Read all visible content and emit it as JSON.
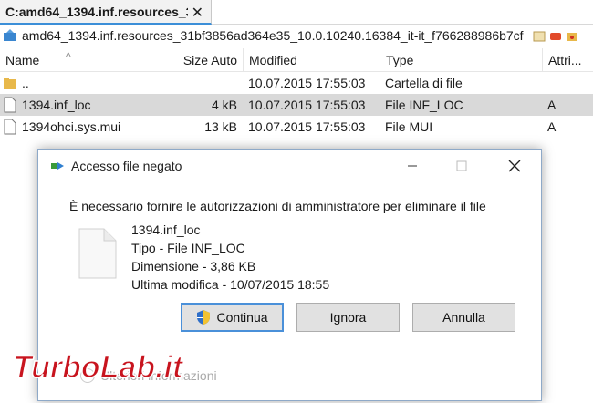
{
  "tab": {
    "title": "C:amd64_1394.inf.resources_3",
    "close": "✕"
  },
  "path": {
    "text": "amd64_1394.inf.resources_31bf3856ad364e35_10.0.10240.16384_it-it_f766288986b7cf"
  },
  "columns": {
    "name": "Name",
    "size": "Size Auto",
    "modified": "Modified",
    "type": "Type",
    "attributes": "Attri..."
  },
  "files": [
    {
      "name": "..",
      "size": "",
      "modified": "10.07.2015 17:55:03",
      "type": "Cartella di file",
      "attr": ""
    },
    {
      "name": "1394.inf_loc",
      "size": "4 kB",
      "modified": "10.07.2015 17:55:03",
      "type": "File INF_LOC",
      "attr": "A"
    },
    {
      "name": "1394ohci.sys.mui",
      "size": "13 kB",
      "modified": "10.07.2015 17:55:03",
      "type": "File MUI",
      "attr": "A"
    }
  ],
  "dialog": {
    "title": "Accesso file negato",
    "message": "È necessario fornire le autorizzazioni di amministratore per eliminare il file",
    "file_name": "1394.inf_loc",
    "file_type": "Tipo - File INF_LOC",
    "file_size": "Dimensione - 3,86 KB",
    "file_modified": "Ultima modifica - 10/07/2015 18:55",
    "continue_label": "Continua",
    "ignore_label": "Ignora",
    "cancel_label": "Annulla",
    "more_info_label": "Ulteriori informazioni"
  },
  "watermark": {
    "text": "TurboLab.it"
  },
  "colors": {
    "selection": "#d9d9d9",
    "accent": "#4a90d9",
    "folder": "#e8b84a",
    "watermark": "#c8141e"
  }
}
